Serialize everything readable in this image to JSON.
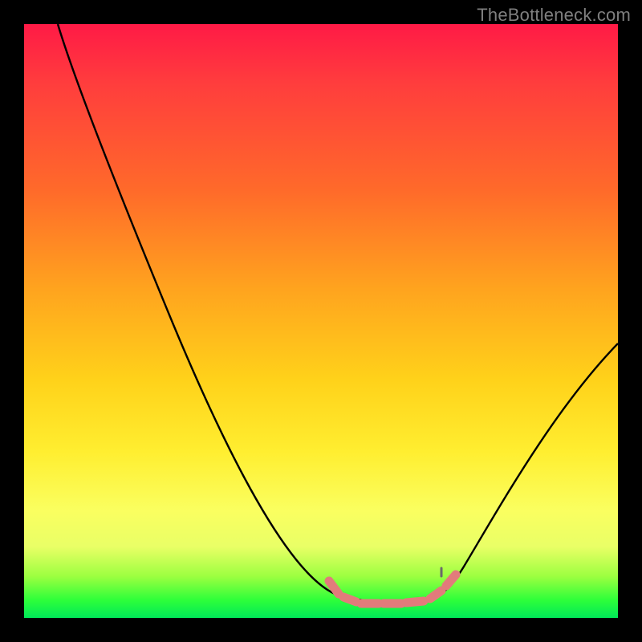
{
  "watermark": "TheBottleneck.com",
  "colors": {
    "background": "#000000",
    "curve": "#000000",
    "marker": "#e27b7b",
    "gradient_stops": [
      "#ff1a46",
      "#ff3d3d",
      "#ff6a2a",
      "#ffa51e",
      "#ffd21a",
      "#ffee30",
      "#faff60",
      "#e9ff66",
      "#9cff40",
      "#2dff3a",
      "#00e858"
    ]
  },
  "chart_data": {
    "type": "line",
    "title": "",
    "xlabel": "",
    "ylabel": "",
    "xlim": [
      0,
      100
    ],
    "ylim": [
      0,
      100
    ],
    "series": [
      {
        "name": "bottleneck-curve",
        "x": [
          5,
          10,
          15,
          20,
          25,
          30,
          35,
          40,
          45,
          50,
          53,
          56,
          60,
          64,
          68,
          70,
          73,
          78,
          83,
          88,
          93,
          98
        ],
        "values": [
          100,
          90,
          80,
          70,
          60,
          50,
          40,
          30,
          20,
          10,
          5,
          2,
          1,
          1,
          1,
          2,
          5,
          12,
          22,
          33,
          44,
          53
        ]
      },
      {
        "name": "optimal-zone-markers",
        "x": [
          53,
          56,
          58,
          60,
          62,
          64,
          66,
          68,
          70
        ],
        "values": [
          5,
          2,
          1.5,
          1,
          1,
          1,
          1.5,
          2,
          5
        ]
      }
    ],
    "note": "values are percentage heights; 0 = bottom (green, optimal), 100 = top (red, severe bottleneck). Axis units are not labeled in the source image and are therefore unitless percentages."
  }
}
